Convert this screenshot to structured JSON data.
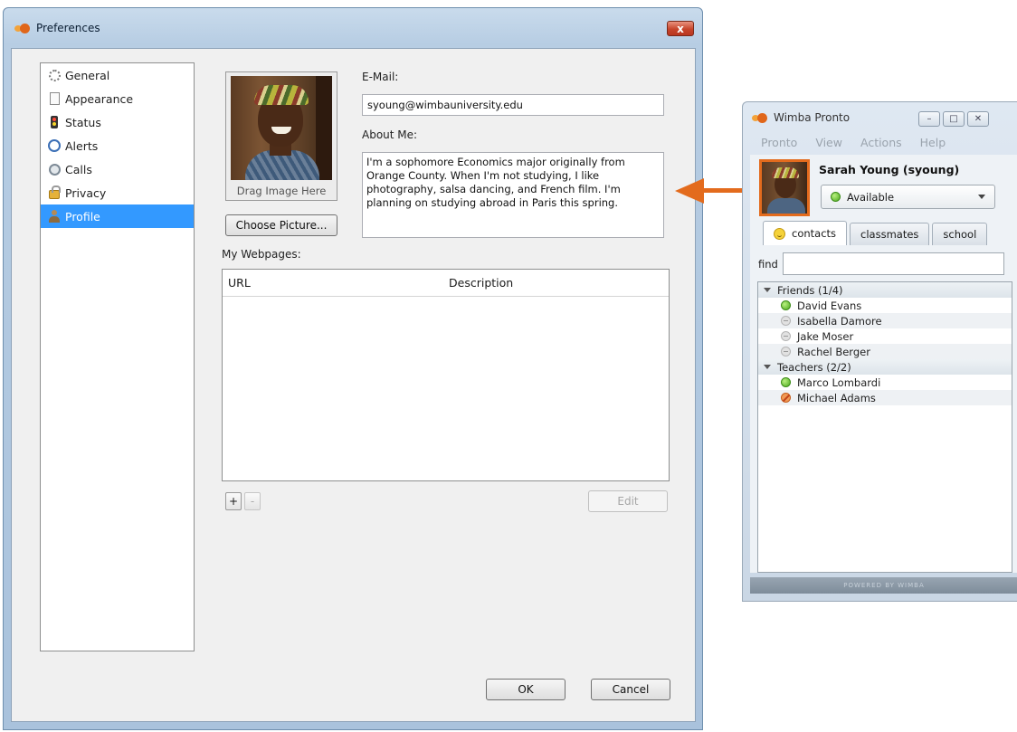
{
  "preferences": {
    "title": "Preferences",
    "close_label": "x",
    "nav": [
      {
        "label": "General",
        "icon": "gear-icon"
      },
      {
        "label": "Appearance",
        "icon": "page-icon"
      },
      {
        "label": "Status",
        "icon": "traffic-light-icon"
      },
      {
        "label": "Alerts",
        "icon": "alert-icon"
      },
      {
        "label": "Calls",
        "icon": "phone-icon"
      },
      {
        "label": "Privacy",
        "icon": "lock-icon"
      },
      {
        "label": "Profile",
        "icon": "person-icon",
        "selected": true
      }
    ],
    "photo_caption": "Drag Image Here",
    "choose_picture": "Choose Picture...",
    "email_label": "E-Mail:",
    "email_value": "syoung@wimbauniversity.edu",
    "about_label": "About Me:",
    "about_value": "I'm a sophomore Economics major originally from Orange County. When I'm not studying, I like photography, salsa dancing, and French film. I'm planning on studying abroad in Paris this spring.",
    "webpages_label": "My Webpages:",
    "webpages_columns": [
      "URL",
      "Description"
    ],
    "add_label": "+",
    "remove_label": "-",
    "edit_label": "Edit",
    "ok_label": "OK",
    "cancel_label": "Cancel"
  },
  "pronto": {
    "title": "Wimba Pronto",
    "window_buttons": [
      "–",
      "□",
      "✕"
    ],
    "menu": [
      "Pronto",
      "View",
      "Actions",
      "Help"
    ],
    "user_name": "Sarah Young (syoung)",
    "status": "Available",
    "tabs": [
      "contacts",
      "classmates",
      "school"
    ],
    "find_label": "find",
    "groups": [
      {
        "name": "Friends (1/4)",
        "contacts": [
          {
            "name": "David Evans",
            "status": "online"
          },
          {
            "name": "Isabella Damore",
            "status": "offline"
          },
          {
            "name": "Jake Moser",
            "status": "offline"
          },
          {
            "name": "Rachel Berger",
            "status": "offline"
          }
        ]
      },
      {
        "name": "Teachers (2/2)",
        "contacts": [
          {
            "name": "Marco Lombardi",
            "status": "online"
          },
          {
            "name": "Michael Adams",
            "status": "busy"
          }
        ]
      }
    ],
    "footer": "POWERED BY WIMBA"
  },
  "colors": {
    "accent_orange": "#e36b1d",
    "selection_blue": "#3399ff",
    "online_green": "#4aa81c"
  }
}
